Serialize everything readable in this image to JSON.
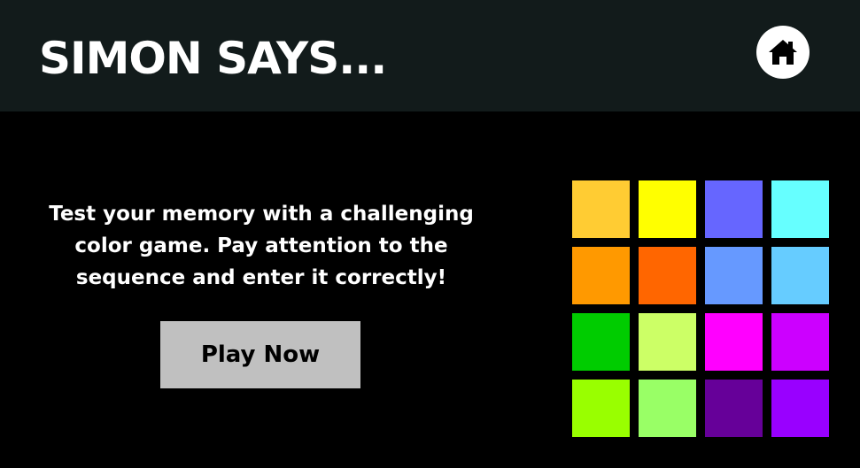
{
  "header": {
    "title": "SIMON SAYS...",
    "home_icon": "home-icon",
    "background": "#121b1b"
  },
  "intro": {
    "text": "Test your memory with a challenging color game. Pay attention to the sequence and enter it correctly!"
  },
  "play_button": {
    "label": "Play Now",
    "background": "#c0c0c0"
  },
  "board": {
    "tiles": [
      {
        "color": "#ffcc33"
      },
      {
        "color": "#ffff00"
      },
      {
        "color": "#6666ff"
      },
      {
        "color": "#66ffff"
      },
      {
        "color": "#ff9900"
      },
      {
        "color": "#ff6600"
      },
      {
        "color": "#6699ff"
      },
      {
        "color": "#66ccff"
      },
      {
        "color": "#00cc00"
      },
      {
        "color": "#ccff66"
      },
      {
        "color": "#ff00ff"
      },
      {
        "color": "#cc00ff"
      },
      {
        "color": "#99ff00"
      },
      {
        "color": "#99ff66"
      },
      {
        "color": "#660099"
      },
      {
        "color": "#9900ff"
      }
    ]
  }
}
